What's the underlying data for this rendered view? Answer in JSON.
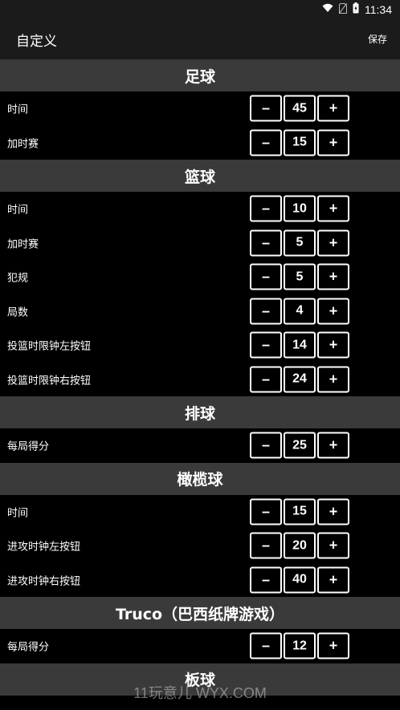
{
  "status": {
    "time": "11:34"
  },
  "appbar": {
    "title": "自定义",
    "save_label": "保存"
  },
  "sections": [
    {
      "title": "足球",
      "rows": [
        {
          "label": "时间",
          "value": "45"
        },
        {
          "label": "加时赛",
          "value": "15"
        }
      ]
    },
    {
      "title": "篮球",
      "rows": [
        {
          "label": "时间",
          "value": "10"
        },
        {
          "label": "加时赛",
          "value": "5"
        },
        {
          "label": "犯规",
          "value": "5"
        },
        {
          "label": "局数",
          "value": "4"
        },
        {
          "label": "投篮时限钟左按钮",
          "value": "14"
        },
        {
          "label": "投篮时限钟右按钮",
          "value": "24"
        }
      ]
    },
    {
      "title": "排球",
      "rows": [
        {
          "label": "每局得分",
          "value": "25"
        }
      ]
    },
    {
      "title": "橄榄球",
      "rows": [
        {
          "label": "时间",
          "value": "15"
        },
        {
          "label": "进攻时钟左按钮",
          "value": "20"
        },
        {
          "label": "进攻时钟右按钮",
          "value": "40"
        }
      ]
    },
    {
      "title": "Truco（巴西纸牌游戏）",
      "rows": [
        {
          "label": "每局得分",
          "value": "12"
        }
      ]
    },
    {
      "title": "板球",
      "rows": []
    }
  ],
  "stepper": {
    "minus": "–",
    "plus": "+"
  },
  "watermark": "11玩意儿 WYX.COM"
}
